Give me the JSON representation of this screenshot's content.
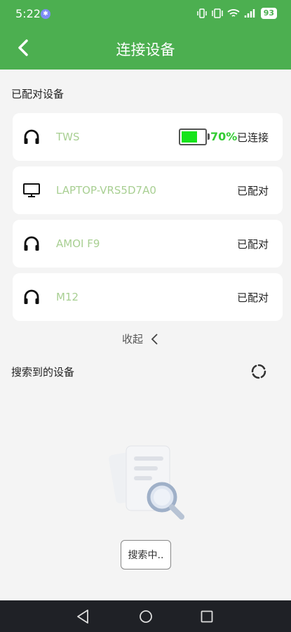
{
  "status_bar": {
    "time": "5:22",
    "bluetooth_badge": "✱",
    "battery_level": "93",
    "icons": [
      "vibrate-icon",
      "nfc-icon",
      "wifi-icon",
      "signal-icon"
    ]
  },
  "header": {
    "title": "连接设备",
    "back_icon": "chevron-left-icon"
  },
  "paired": {
    "section_title": "已配对设备",
    "devices": [
      {
        "name": "TWS",
        "icon": "headphones-icon",
        "status": "已连接",
        "battery_percent": "70%",
        "battery_level": 0.7
      },
      {
        "name": "LAPTOP-VRS5D7A0",
        "icon": "monitor-icon",
        "status": "已配对"
      },
      {
        "name": "AMOI F9",
        "icon": "headphones-icon",
        "status": "已配对"
      },
      {
        "name": "M12",
        "icon": "headphones-icon",
        "status": "已配对"
      }
    ],
    "collapse_label": "收起"
  },
  "discovered": {
    "section_title": "搜索到的设备",
    "refresh_icon": "refresh-icon",
    "search_button": "搜索中.."
  },
  "colors": {
    "header": "#4caf50",
    "device_name": "#a8cf92",
    "battery_fill": "#16e41b",
    "battery_text": "#33cc33"
  }
}
